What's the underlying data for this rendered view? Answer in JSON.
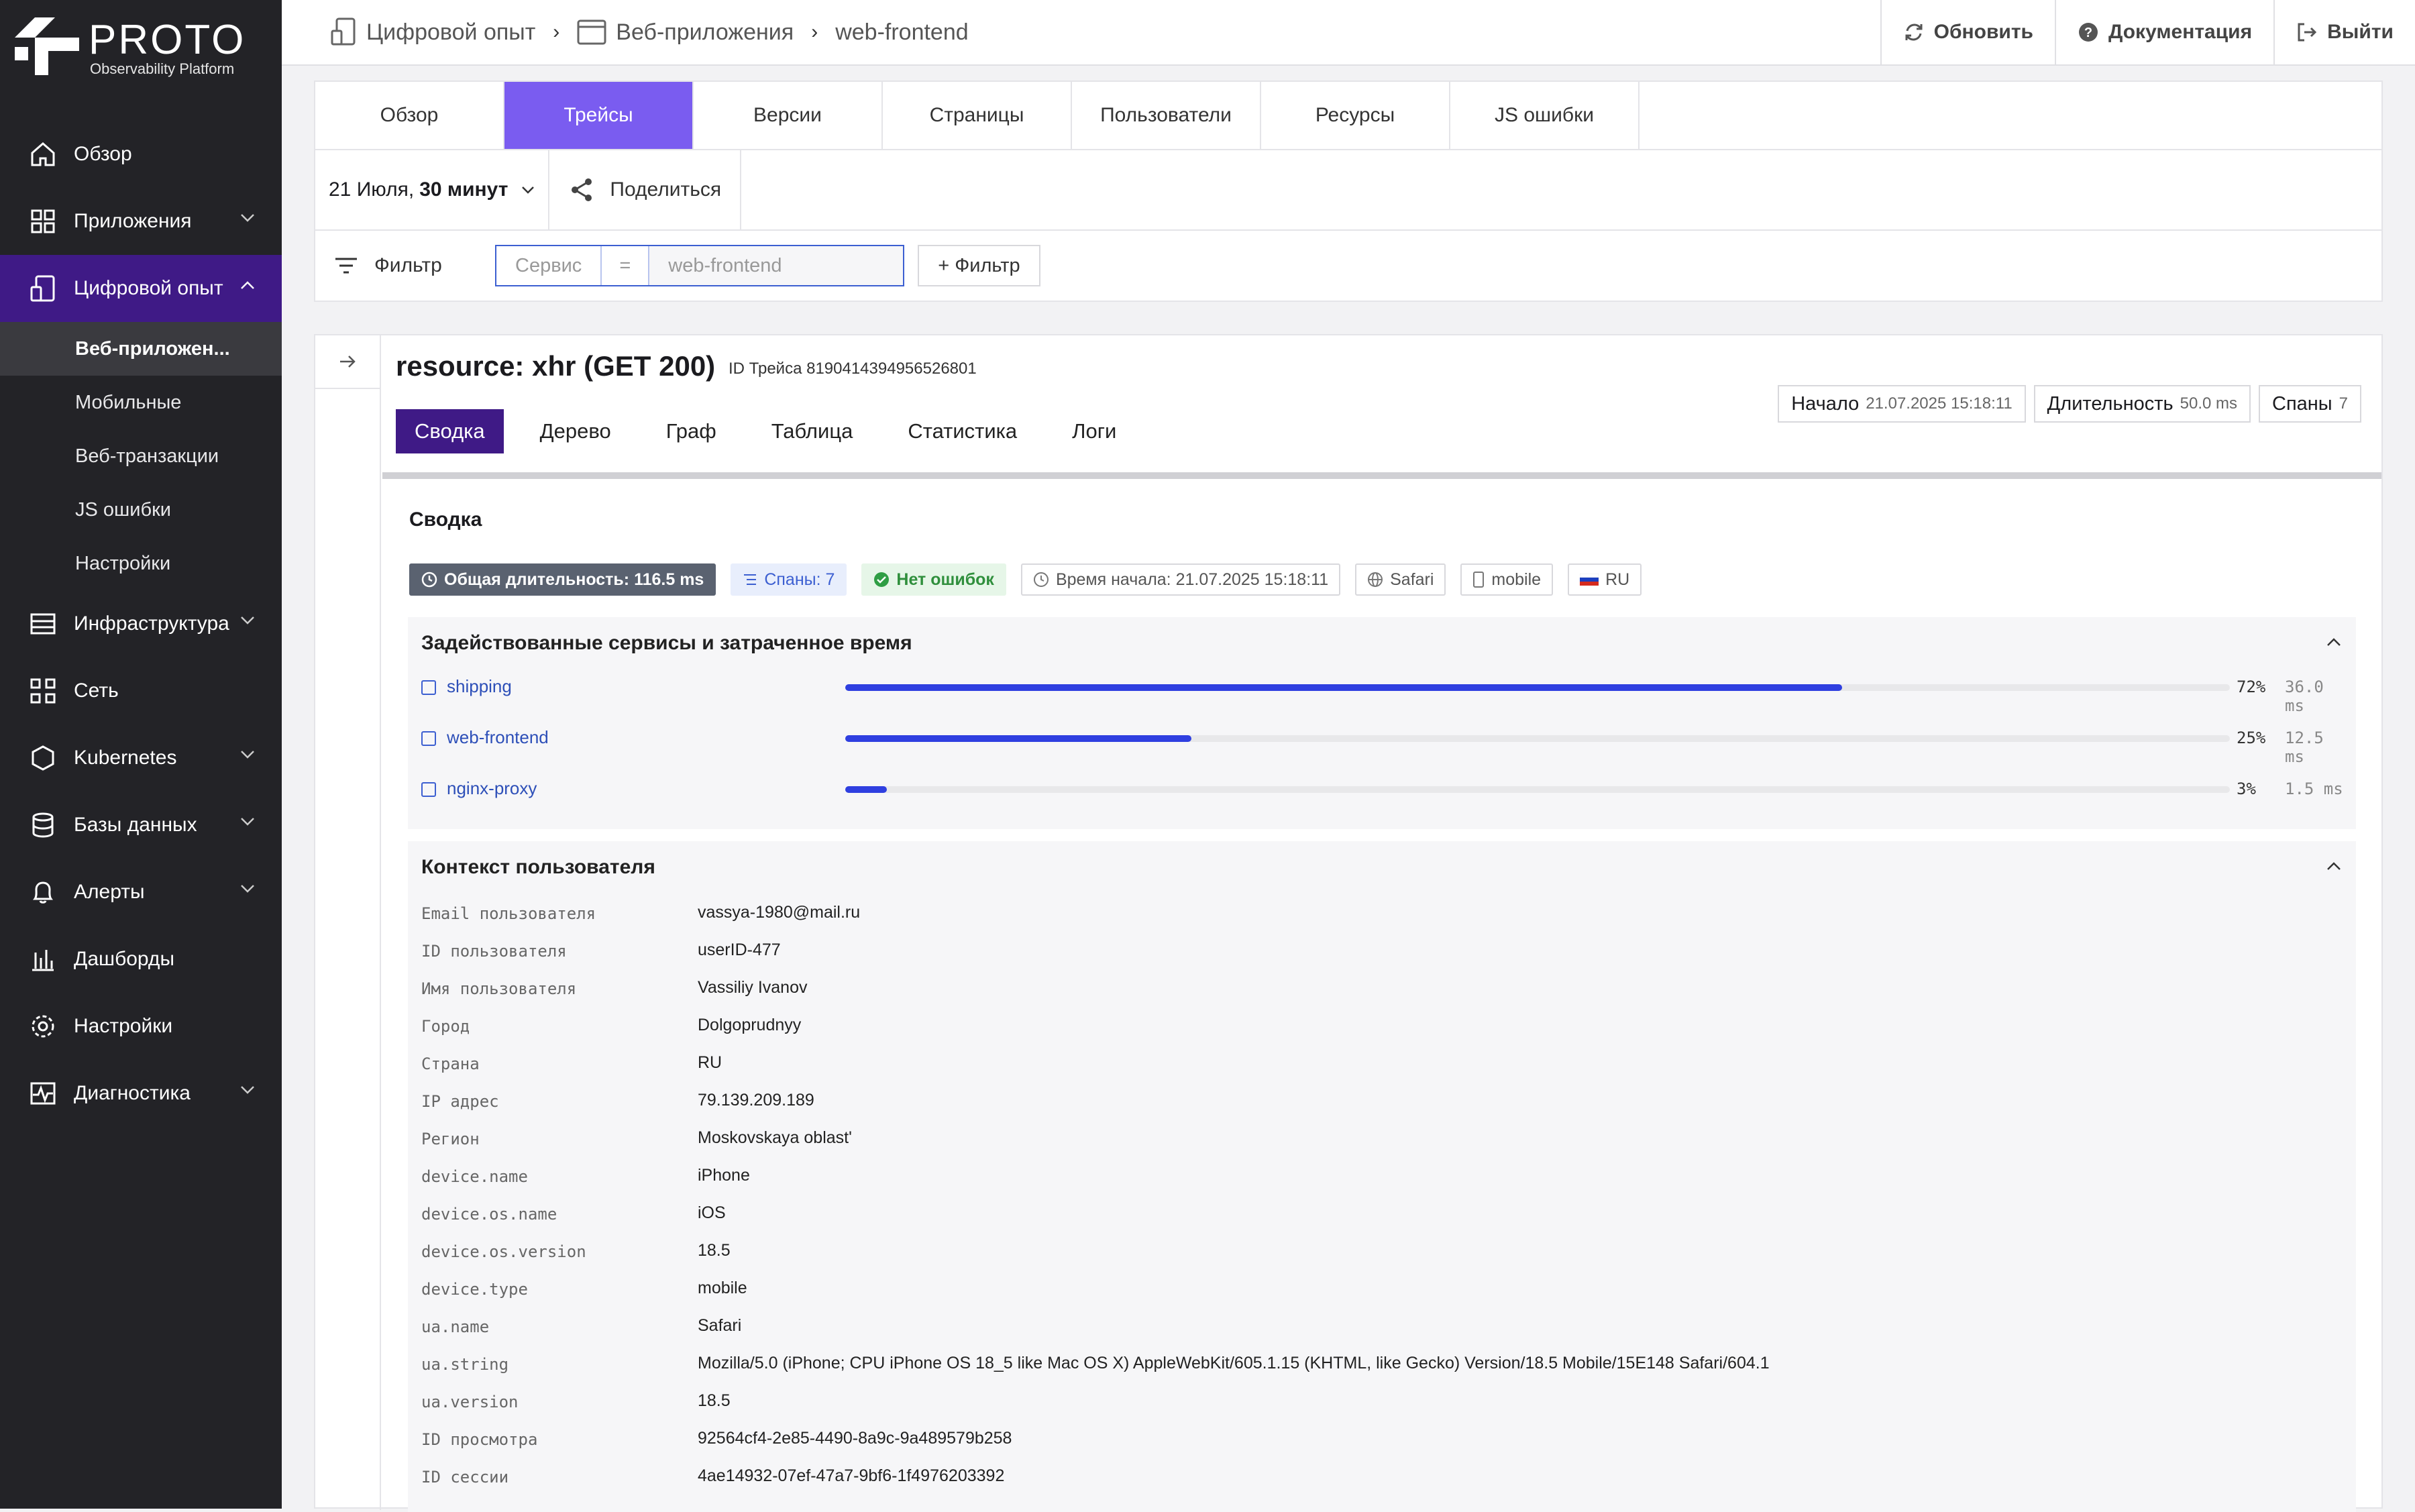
{
  "logo": {
    "brand": "PROTO",
    "subtitle": "Observability Platform"
  },
  "sidebar": {
    "items": [
      {
        "label": "Обзор",
        "icon": "home-icon"
      },
      {
        "label": "Приложения",
        "icon": "grid-icon",
        "expandable": true
      },
      {
        "label": "Цифровой опыт",
        "icon": "device-icon",
        "expandable": true,
        "active": true
      },
      {
        "label": "Инфраструктура",
        "icon": "server-icon",
        "expandable": true
      },
      {
        "label": "Сеть",
        "icon": "network-icon"
      },
      {
        "label": "Kubernetes",
        "icon": "kubernetes-icon",
        "expandable": true
      },
      {
        "label": "Базы данных",
        "icon": "database-icon",
        "expandable": true
      },
      {
        "label": "Алерты",
        "icon": "bell-icon",
        "expandable": true
      },
      {
        "label": "Дашборды",
        "icon": "chart-icon"
      },
      {
        "label": "Настройки",
        "icon": "gear-icon"
      },
      {
        "label": "Диагностика",
        "icon": "pulse-icon",
        "expandable": true
      }
    ],
    "subitems": [
      "Веб-приложен...",
      "Мобильные",
      "Веб-транзакции",
      "JS ошибки",
      "Настройки"
    ]
  },
  "breadcrumb": {
    "item1": "Цифровой опыт",
    "item2": "Веб-приложения",
    "item3": "web-frontend"
  },
  "top_actions": {
    "refresh": "Обновить",
    "docs": "Документация",
    "logout": "Выйти"
  },
  "tabs": [
    "Обзор",
    "Трейсы",
    "Версии",
    "Страницы",
    "Пользователи",
    "Ресурсы",
    "JS ошибки"
  ],
  "active_tab": "Трейсы",
  "time": {
    "date": "21 Июля,",
    "range": "30 минут",
    "share": "Поделиться"
  },
  "filter": {
    "label": "Фильтр",
    "field_placeholder": "Сервис",
    "operator": "=",
    "value_placeholder": "web-frontend",
    "add": "+ Фильтр"
  },
  "trace": {
    "title": "resource: xhr (GET 200)",
    "id_label": "ID Трейса 8190414394956526801",
    "tabs": [
      "Сводка",
      "Дерево",
      "Граф",
      "Таблица",
      "Статистика",
      "Логи"
    ],
    "active_tab": "Сводка",
    "start_label": "Начало",
    "start_value": "21.07.2025 15:18:11",
    "duration_label": "Длительность",
    "duration_value": "50.0 ms",
    "spans_label": "Спаны",
    "spans_value": "7"
  },
  "summary": {
    "title": "Сводка",
    "badges": {
      "total": "Общая длительность: 116.5 ms",
      "spans": "Спаны: 7",
      "errors": "Нет ошибок",
      "start": "Время начала: 21.07.2025 15:18:11",
      "browser": "Safari",
      "device": "mobile",
      "country": "RU"
    }
  },
  "services_section": {
    "title": "Задействованные сервисы и затраченное время",
    "rows": [
      {
        "name": "shipping",
        "percent": "72%",
        "ms": "36.0 ms",
        "fraction": 0.72
      },
      {
        "name": "web-frontend",
        "percent": "25%",
        "ms": "12.5 ms",
        "fraction": 0.25
      },
      {
        "name": "nginx-proxy",
        "percent": "3%",
        "ms": "1.5 ms",
        "fraction": 0.03
      }
    ]
  },
  "context_section": {
    "title": "Контекст пользователя",
    "rows": [
      {
        "key": "Email пользователя",
        "value": "vassya-1980@mail.ru"
      },
      {
        "key": "ID пользователя",
        "value": "userID-477"
      },
      {
        "key": "Имя пользователя",
        "value": "Vassiliy Ivanov"
      },
      {
        "key": "Город",
        "value": "Dolgoprudnyy"
      },
      {
        "key": "Страна",
        "value": "RU"
      },
      {
        "key": "IP адрес",
        "value": "79.139.209.189"
      },
      {
        "key": "Регион",
        "value": "Moskovskaya oblast'"
      },
      {
        "key": "device.name",
        "value": "iPhone"
      },
      {
        "key": "device.os.name",
        "value": "iOS"
      },
      {
        "key": "device.os.version",
        "value": "18.5"
      },
      {
        "key": "device.type",
        "value": "mobile"
      },
      {
        "key": "ua.name",
        "value": "Safari"
      },
      {
        "key": "ua.string",
        "value": "Mozilla/5.0 (iPhone; CPU iPhone OS 18_5 like Mac OS X) AppleWebKit/605.1.15 (KHTML, like Gecko) Version/18.5 Mobile/15E148 Safari/604.1"
      },
      {
        "key": "ua.version",
        "value": "18.5"
      },
      {
        "key": "ID просмотра",
        "value": "92564cf4-2e85-4490-8a9c-9a489579b258"
      },
      {
        "key": "ID сессии",
        "value": "4ae14932-07ef-47a7-9bf6-1f4976203392"
      }
    ]
  },
  "colors": {
    "sidebar_bg": "#232327",
    "active_nav": "#3f1a86",
    "active_tab": "#7a5cf0",
    "bar": "#2f3fe0",
    "link": "#2d4fb8"
  }
}
